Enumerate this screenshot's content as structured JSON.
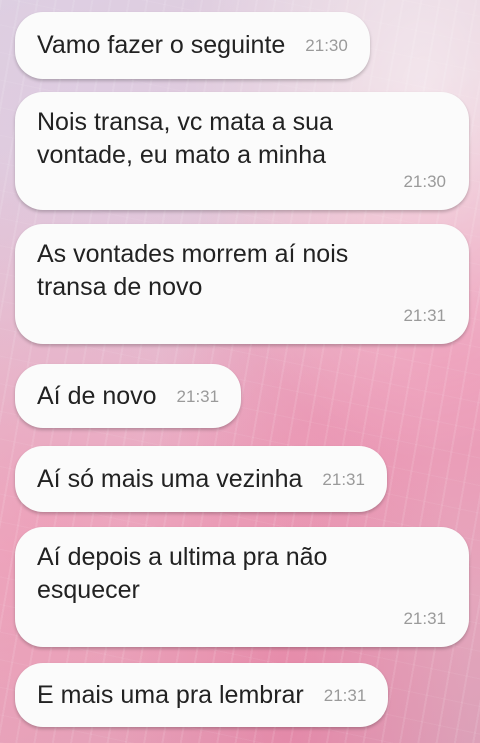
{
  "messages": [
    {
      "text": "Vamo fazer o seguinte",
      "time": "21:30"
    },
    {
      "text": "Nois transa, vc mata a sua\nvontade, eu mato a minha",
      "time": "21:30"
    },
    {
      "text": "As vontades morrem aí nois\ntransa de novo",
      "time": "21:31"
    },
    {
      "text": "Aí de novo",
      "time": "21:31"
    },
    {
      "text": "Aí só mais uma vezinha",
      "time": "21:31"
    },
    {
      "text": "Aí depois a ultima pra não\nesquecer",
      "time": "21:31"
    },
    {
      "text": "E mais uma pra lembrar",
      "time": "21:31"
    }
  ]
}
